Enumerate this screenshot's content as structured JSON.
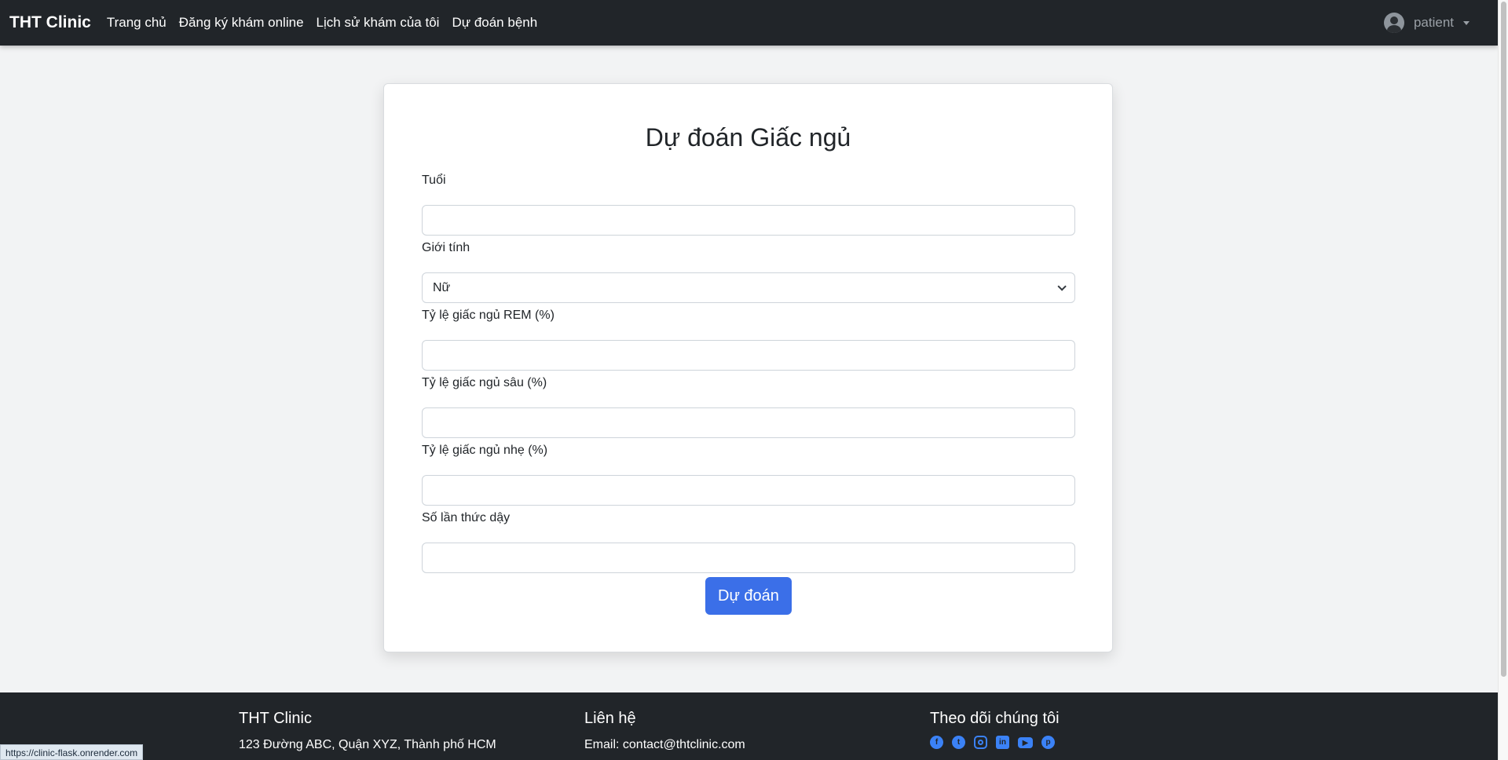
{
  "navbar": {
    "brand": "THT Clinic",
    "links": [
      "Trang chủ",
      "Đăng ký khám online",
      "Lịch sử khám của tôi",
      "Dự đoán bệnh"
    ],
    "user": "patient"
  },
  "form": {
    "title": "Dự đoán Giấc ngủ",
    "fields": {
      "age": {
        "label": "Tuổi",
        "value": ""
      },
      "gender": {
        "label": "Giới tính",
        "selected": "Nữ"
      },
      "rem": {
        "label": "Tỷ lệ giấc ngủ REM (%)",
        "value": ""
      },
      "deep": {
        "label": "Tỷ lệ giấc ngủ sâu (%)",
        "value": ""
      },
      "light": {
        "label": "Tỷ lệ giấc ngủ nhẹ (%)",
        "value": ""
      },
      "awakenings": {
        "label": "Số lần thức dậy",
        "value": ""
      }
    },
    "submit_label": "Dự đoán"
  },
  "footer": {
    "col1": {
      "heading": "THT Clinic",
      "address": "123 Đường ABC, Quận XYZ, Thành phố HCM"
    },
    "col2": {
      "heading": "Liên hệ",
      "email": "Email: contact@thtclinic.com"
    },
    "col3": {
      "heading": "Theo dõi chúng tôi",
      "icons": [
        "facebook-icon",
        "twitter-icon",
        "instagram-icon",
        "linkedin-icon",
        "youtube-icon",
        "pinterest-icon"
      ]
    },
    "accent_color": "#3b82f6"
  },
  "status_bar_url": "https://clinic-flask.onrender.com"
}
